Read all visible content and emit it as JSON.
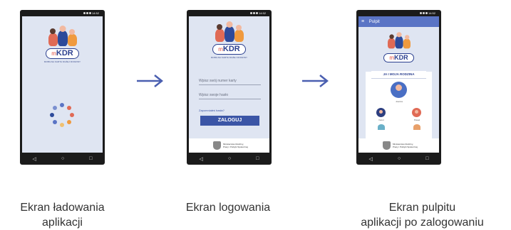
{
  "screens": [
    {
      "caption_line1": "Ekran ładowania",
      "caption_line2": "aplikacji"
    },
    {
      "caption_line1": "Ekran logowania",
      "caption_line2": "",
      "login": {
        "card_number_placeholder": "Wpisz swój numer karty",
        "password_placeholder": "Wpisz swoje hasło",
        "forgot_password": "Zapomniałeś hasła?",
        "login_button": "ZALOGUJ"
      }
    },
    {
      "caption_line1": "Ekran pulpitu",
      "caption_line2": "aplikacji po zalogowaniu",
      "dashboard": {
        "appbar_title": "Pulpit",
        "menu_icon": "hamburger-icon",
        "card_title": "JA I MOJA RODZINA",
        "main_user": "Joanna",
        "members": [
          "Karol",
          "Paweł"
        ]
      }
    }
  ],
  "app": {
    "logo_prefix": "m",
    "logo_main": "KDR",
    "tagline": "MOBILNA KARTA DUŻEJ RODZINY",
    "ministry_line1": "Ministerstwo Rodziny,",
    "ministry_line2": "Pracy i Polityki Społecznej",
    "status_time": "14:52"
  },
  "colors": {
    "screen_bg": "#dfe5f2",
    "brand_blue": "#2b3f8f",
    "button_blue": "#3b55a6",
    "appbar_blue": "#5a74c5",
    "arrow_blue": "#4a5fb0"
  }
}
